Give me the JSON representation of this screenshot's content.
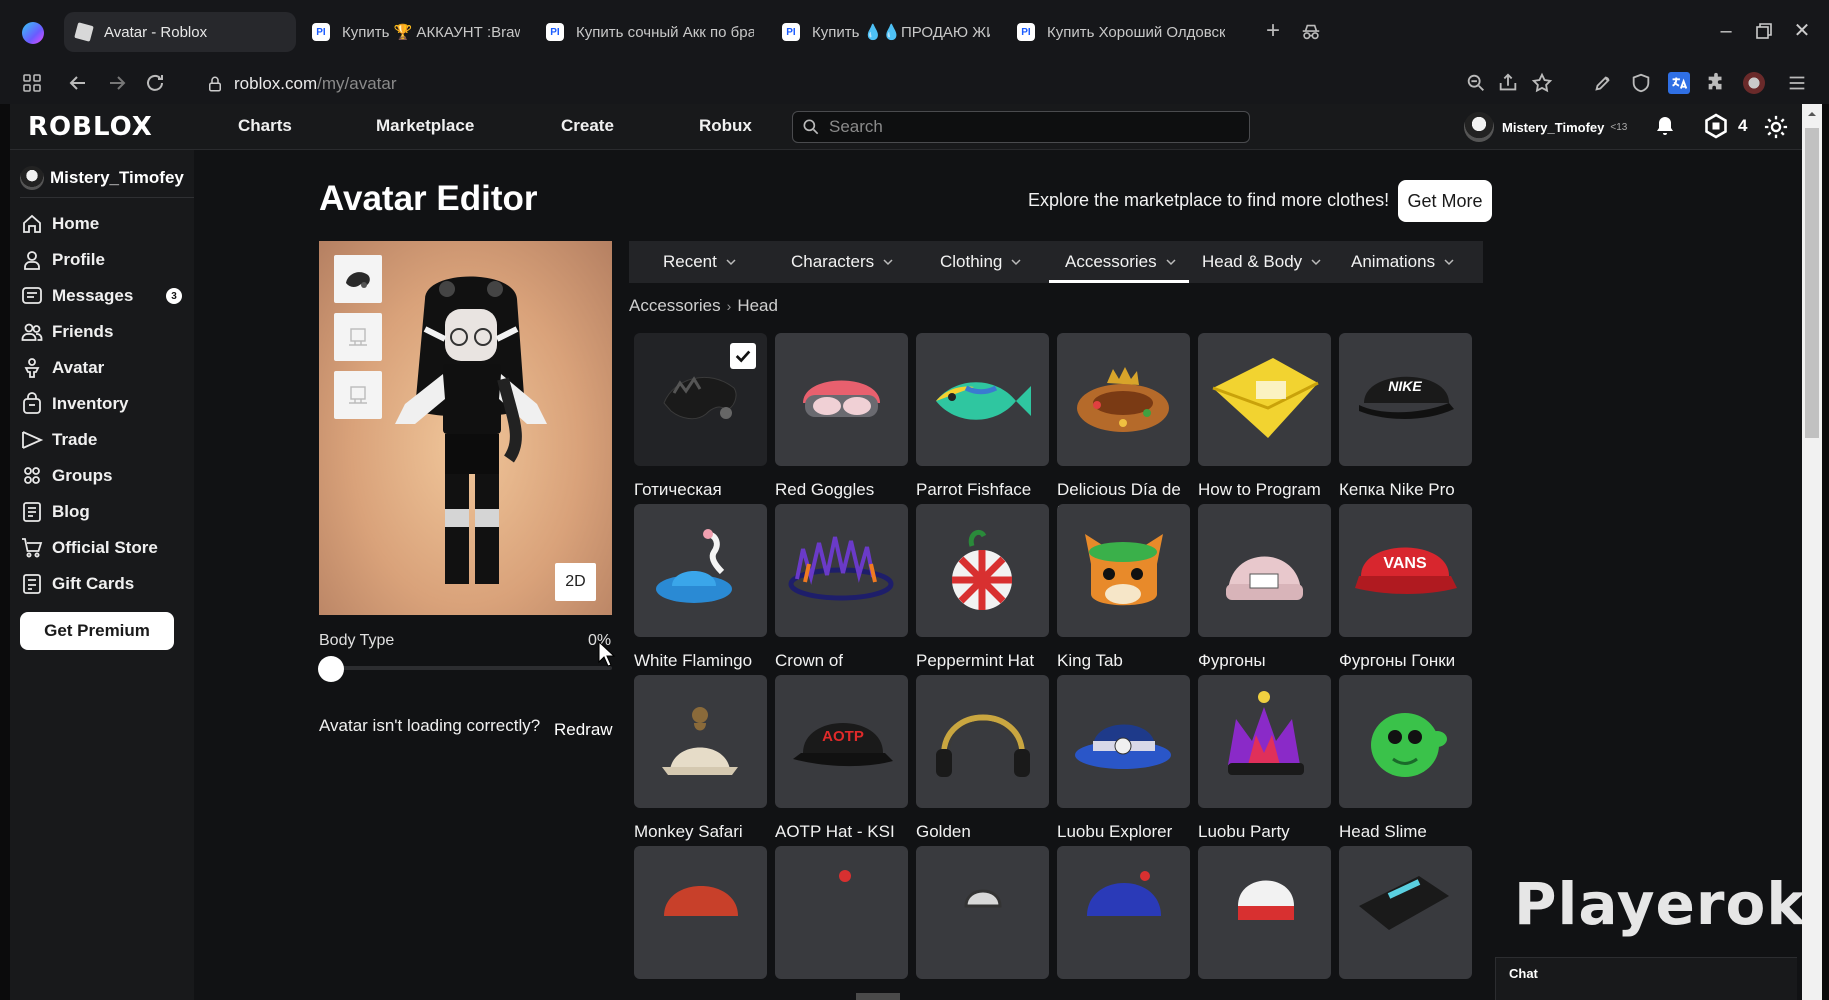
{
  "browser": {
    "tabs": [
      {
        "title": "Avatar - Roblox",
        "icon": "roblox-icon"
      },
      {
        "title": "Купить 🏆 АККАУНТ :Brawl Stars",
        "icon": "playerok-icon"
      },
      {
        "title": "Купить сочный Акк по бравл",
        "icon": "playerok-icon"
      },
      {
        "title": "Купить 💧💧ПРОДАЮ ЖИРНЫЙ",
        "icon": "playerok-icon"
      },
      {
        "title": "Купить Хороший Олдовский",
        "icon": "playerok-icon"
      }
    ],
    "fav_text": "PI",
    "url_host": "roblox.com",
    "url_path": "/my/avatar"
  },
  "header": {
    "logo": "ROBLOX",
    "nav": [
      "Charts",
      "Marketplace",
      "Create",
      "Robux"
    ],
    "search_placeholder": "Search",
    "username": "Mistery_Timofey",
    "age_badge": "<13",
    "robux": "4"
  },
  "sidebar": {
    "username": "Mistery_Timofey",
    "items": [
      {
        "label": "Home",
        "icon": "home-icon"
      },
      {
        "label": "Profile",
        "icon": "profile-icon"
      },
      {
        "label": "Messages",
        "icon": "messages-icon",
        "badge": "3"
      },
      {
        "label": "Friends",
        "icon": "friends-icon"
      },
      {
        "label": "Avatar",
        "icon": "avatar-icon"
      },
      {
        "label": "Inventory",
        "icon": "inventory-icon"
      },
      {
        "label": "Trade",
        "icon": "trade-icon"
      },
      {
        "label": "Groups",
        "icon": "groups-icon"
      },
      {
        "label": "Blog",
        "icon": "blog-icon"
      },
      {
        "label": "Official Store",
        "icon": "store-icon"
      },
      {
        "label": "Gift Cards",
        "icon": "gift-card-icon"
      }
    ],
    "premium_label": "Get Premium"
  },
  "editor": {
    "title": "Avatar Editor",
    "explore_text": "Explore the marketplace to find more clothes!",
    "get_more": "Get More",
    "btn_2d": "2D",
    "body_type_label": "Body Type",
    "body_type_value": "0%",
    "body_type_fraction": 0,
    "loading_question": "Avatar isn't loading correctly?",
    "redraw": "Redraw",
    "tabs": [
      "Recent",
      "Characters",
      "Clothing",
      "Accessories",
      "Head & Body",
      "Animations"
    ],
    "active_tab": "Accessories",
    "breadcrumb": [
      "Accessories",
      "Head"
    ],
    "items": [
      {
        "name": "Готическая корона эльфов",
        "selected": true
      },
      {
        "name": "Red Goggles Helmet"
      },
      {
        "name": "Parrot Fishface"
      },
      {
        "name": "Delicious Día de los Reyes Hat"
      },
      {
        "name": "How to Program BASIC"
      },
      {
        "name": "Кепка Nike Pro"
      },
      {
        "name": "White Flamingo Fedora"
      },
      {
        "name": "Crown of Electrifying..."
      },
      {
        "name": "Peppermint Hat"
      },
      {
        "name": "King Tab"
      },
      {
        "name": "Фургоны Розовый..."
      },
      {
        "name": "Фургоны Гонки Красное..."
      },
      {
        "name": "Monkey Safari Hat"
      },
      {
        "name": "AOTP Hat - KSI"
      },
      {
        "name": "Golden Headphones -..."
      },
      {
        "name": "Luobu Explorer Hat"
      },
      {
        "name": "Luobu Party Crown"
      },
      {
        "name": "Head Slime"
      },
      {
        "name": ""
      },
      {
        "name": ""
      },
      {
        "name": ""
      },
      {
        "name": ""
      },
      {
        "name": ""
      },
      {
        "name": ""
      }
    ]
  },
  "watermark": "Playerok",
  "chat_label": "Chat",
  "item_art": {
    "aotp": "AOTP",
    "nike": "NIKE",
    "vans": "VANS"
  }
}
